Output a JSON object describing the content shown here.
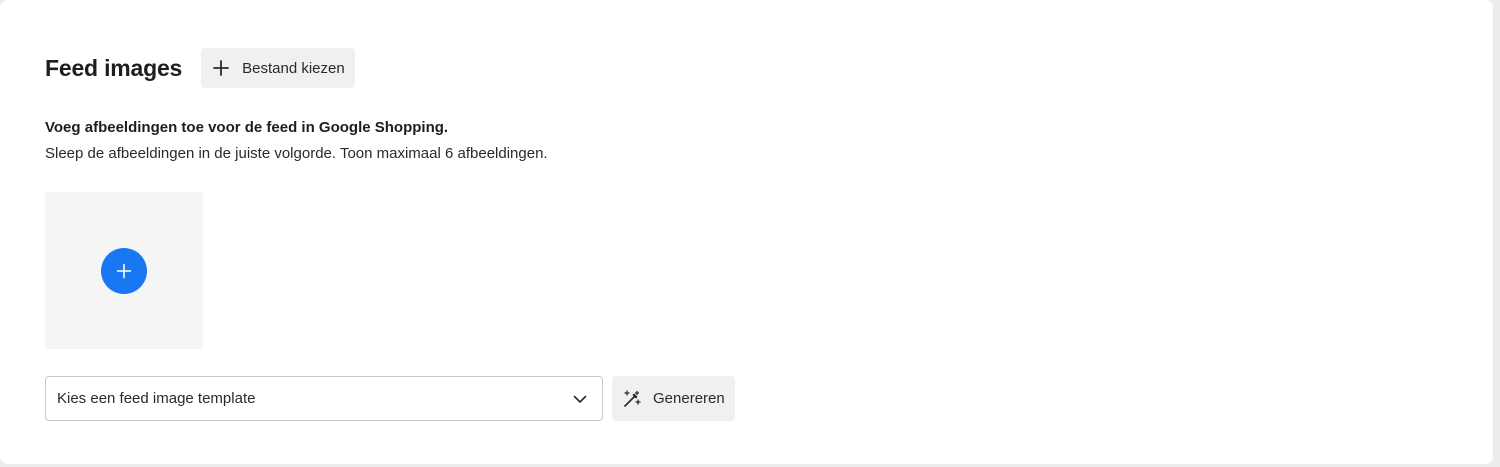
{
  "section": {
    "title": "Feed images",
    "choose_file_label": "Bestand kiezen",
    "choose_file_icon": "plus-icon"
  },
  "description": {
    "bold": "Voeg afbeeldingen toe voor de feed in Google Shopping.",
    "normal": "Sleep de afbeeldingen in de juiste volgorde. Toon maximaal 6 afbeeldingen."
  },
  "dropzone": {
    "add_icon": "plus-circle-icon",
    "accent_color": "#1877f2"
  },
  "template_select": {
    "placeholder": "Kies een feed image template",
    "icon": "chevron-down-icon"
  },
  "generate": {
    "label": "Genereren",
    "icon": "magic-wand-icon"
  }
}
